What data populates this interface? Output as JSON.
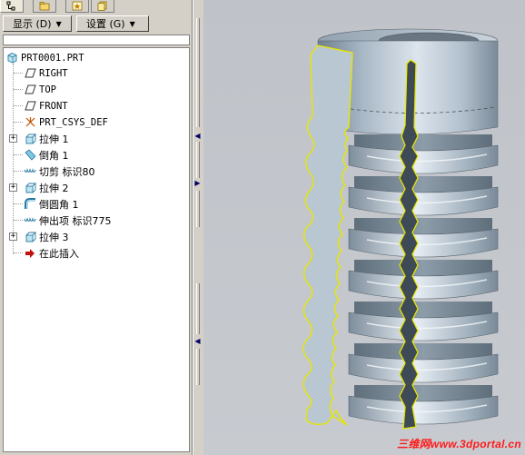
{
  "toolbar": {
    "show_label": "显示 (D)",
    "settings_label": "设置 (G)"
  },
  "tabs": [
    {
      "icon": "model-tree-icon",
      "active": true
    },
    {
      "icon": "folder-browser-icon",
      "active": false
    },
    {
      "icon": "favorites-icon",
      "active": false
    },
    {
      "icon": "layers-icon",
      "active": false
    }
  ],
  "tree": {
    "root": "PRT0001.PRT",
    "items": [
      {
        "label": "RIGHT",
        "icon": "datum-plane-icon"
      },
      {
        "label": "TOP",
        "icon": "datum-plane-icon"
      },
      {
        "label": "FRONT",
        "icon": "datum-plane-icon"
      },
      {
        "label": "PRT_CSYS_DEF",
        "icon": "coordinate-system-icon"
      },
      {
        "label": "拉伸 1",
        "icon": "extrude-icon",
        "expandable": true
      },
      {
        "label": "倒角 1",
        "icon": "chamfer-icon"
      },
      {
        "label": "切剪 标识80",
        "icon": "cut-icon"
      },
      {
        "label": "拉伸 2",
        "icon": "extrude-icon",
        "expandable": true
      },
      {
        "label": "倒圆角 1",
        "icon": "round-icon"
      },
      {
        "label": "伸出项 标识775",
        "icon": "protrusion-icon"
      },
      {
        "label": "拉伸 3",
        "icon": "extrude-icon",
        "expandable": true
      },
      {
        "label": "在此插入",
        "icon": "insert-here-arrow-icon"
      }
    ]
  },
  "watermark": "三维网www.3dportal.cn",
  "colors": {
    "background": "#c4c8cd",
    "model_surface": "#a9b8c6",
    "section_face": "#b4c3d0",
    "section_edge": "#e6e600",
    "watermark": "#ff1a1a"
  }
}
